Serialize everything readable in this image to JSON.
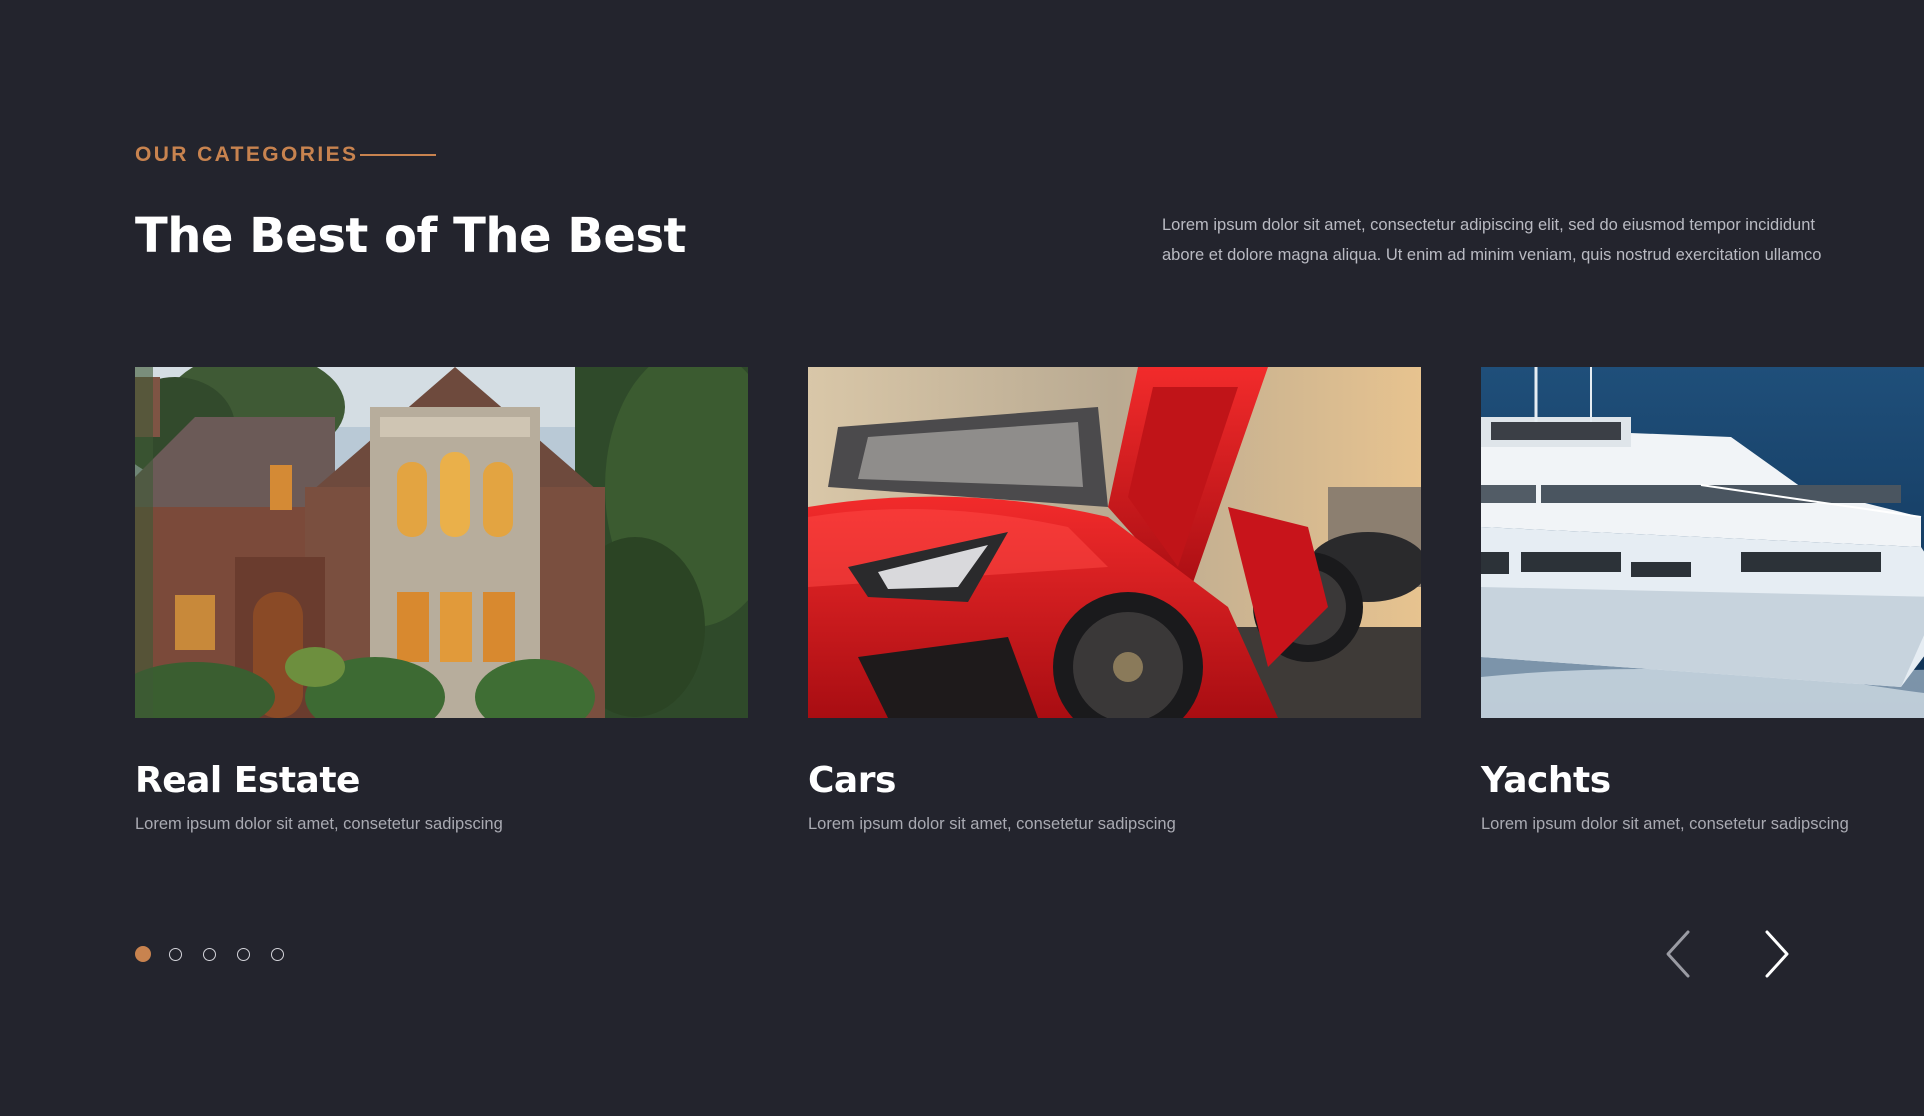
{
  "section": {
    "eyebrow": "OUR CATEGORIES",
    "title": "The Best of The Best",
    "intro_line1": "Lorem ipsum dolor sit amet, consectetur adipiscing elit, sed do eiusmod tempor incididunt",
    "intro_line2": "abore et dolore magna aliqua. Ut enim ad minim veniam, quis nostrud exercitation ullamco"
  },
  "cards": [
    {
      "title": "Real Estate",
      "description": "Lorem ipsum dolor sit amet, consetetur sadipscing",
      "image": "house-photo"
    },
    {
      "title": "Cars",
      "description": "Lorem ipsum dolor sit amet, consetetur sadipscing",
      "image": "sports-car-photo"
    },
    {
      "title": "Yachts",
      "description": "Lorem ipsum dolor sit amet, consetetur sadipscing",
      "image": "yacht-photo"
    }
  ],
  "pagination": {
    "total": 5,
    "active": 1
  },
  "navigation": {
    "prev_icon": "chevron-left-icon",
    "next_icon": "chevron-right-icon"
  },
  "colors": {
    "background": "#23242d",
    "accent": "#c8834f",
    "heading": "#ffffff",
    "body_text": "#b9bac2"
  }
}
